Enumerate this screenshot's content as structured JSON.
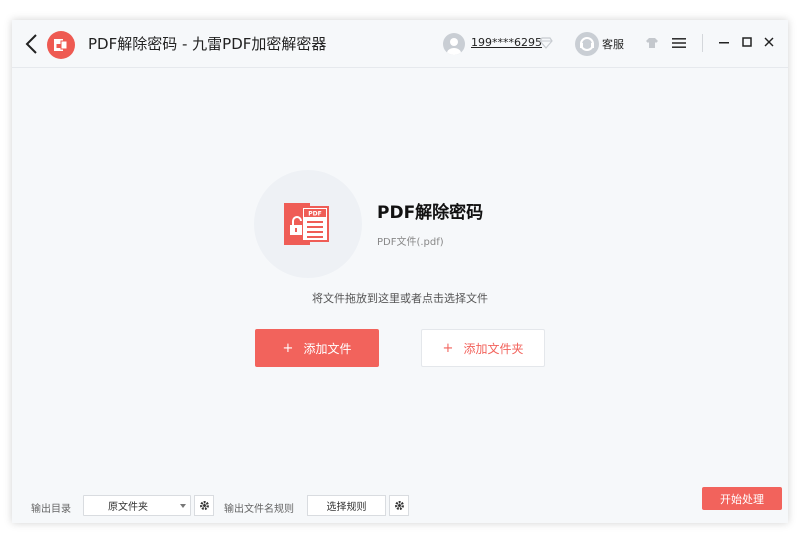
{
  "titlebar": {
    "title": "PDF解除密码 - 九雷PDF加密解密器",
    "username": "199****6295",
    "service_label": "客服"
  },
  "tool": {
    "title": "PDF解除密码",
    "subtitle": "PDF文件(.pdf)",
    "icon_badge": "PDF",
    "drop_hint": "将文件拖放到这里或者点击选择文件"
  },
  "actions": {
    "add_file_label": "添加文件",
    "add_folder_label": "添加文件夹",
    "plus": "+"
  },
  "bottom": {
    "output_dir_label": "输出目录",
    "output_dir_value": "原文件夹",
    "filename_rule_label": "输出文件名规则",
    "choose_rule_label": "选择规则",
    "start_label": "开始处理"
  },
  "colors": {
    "accent": "#f2635c",
    "background": "#f6f8fa"
  }
}
